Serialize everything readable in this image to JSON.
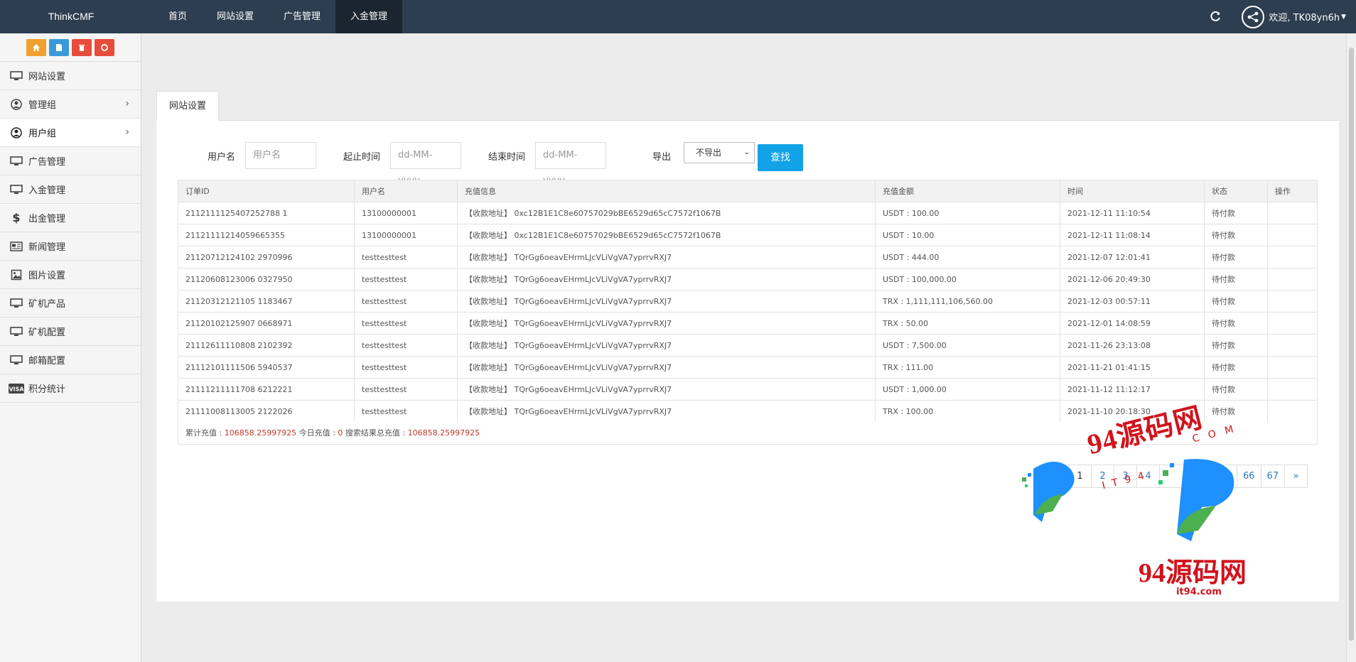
{
  "brand": "ThinkCMF",
  "nav": [
    {
      "label": "首页",
      "active": false
    },
    {
      "label": "网站设置",
      "active": false
    },
    {
      "label": "广告管理",
      "active": false
    },
    {
      "label": "入金管理",
      "active": true
    }
  ],
  "user": {
    "welcome": "欢迎, TK08yn6h"
  },
  "sidebar": {
    "items": [
      {
        "label": "网站设置",
        "icon": "monitor-icon"
      },
      {
        "label": "管理组",
        "icon": "user-circle-icon",
        "has_children": true
      },
      {
        "label": "用户组",
        "icon": "user-circle-icon",
        "has_children": true,
        "active": true
      },
      {
        "label": "广告管理",
        "icon": "monitor-icon"
      },
      {
        "label": "入金管理",
        "icon": "monitor-icon"
      },
      {
        "label": "出金管理",
        "icon": "dollar-icon"
      },
      {
        "label": "新闻管理",
        "icon": "newspaper-icon"
      },
      {
        "label": "图片设置",
        "icon": "image-icon"
      },
      {
        "label": "矿机产品",
        "icon": "monitor-icon"
      },
      {
        "label": "矿机配置",
        "icon": "monitor-icon"
      },
      {
        "label": "邮箱配置",
        "icon": "monitor-icon"
      },
      {
        "label": "积分统计",
        "icon": "visa-icon"
      }
    ]
  },
  "tab": {
    "label": "网站设置"
  },
  "filters": {
    "username_label": "用户名",
    "username_placeholder": "用户名",
    "start_label": "起止时间",
    "start_placeholder": "dd-MM-yyyy",
    "end_label": "结束时间",
    "end_placeholder": "dd-MM-yyyy",
    "export_label": "导出",
    "export_value": "不导出",
    "search_button": "查找"
  },
  "table": {
    "headers": [
      "订单ID",
      "用户名",
      "充值信息",
      "充值金额",
      "时间",
      "状态",
      "操作"
    ],
    "rows": [
      [
        "2112111125407252788 1",
        "13100000001",
        "【收款地址】 0xc12B1E1C8e60757029bBE6529d65cC7572f1067B",
        "USDT : 100.00",
        "2021-12-11 11:10:54",
        "待付款",
        ""
      ],
      [
        "21121111214059665355",
        "13100000001",
        "【收款地址】 0xc12B1E1C8e60757029bBE6529d65cC7572f1067B",
        "USDT : 10.00",
        "2021-12-11 11:08:14",
        "待付款",
        ""
      ],
      [
        "21120712124102 2970996",
        "testtesttest",
        "【收款地址】 TQrGg6oeavEHrmLJcVLiVgVA7yprrvRXJ7",
        "USDT : 444.00",
        "2021-12-07 12:01:41",
        "待付款",
        ""
      ],
      [
        "21120608123006 0327950",
        "testtesttest",
        "【收款地址】 TQrGg6oeavEHrmLJcVLiVgVA7yprrvRXJ7",
        "USDT : 100,000.00",
        "2021-12-06 20:49:30",
        "待付款",
        ""
      ],
      [
        "21120312121105 1183467",
        "testtesttest",
        "【收款地址】 TQrGg6oeavEHrmLJcVLiVgVA7yprrvRXJ7",
        "TRX : 1,111,111,106,560.00",
        "2021-12-03 00:57:11",
        "待付款",
        ""
      ],
      [
        "21120102125907 0668971",
        "testtesttest",
        "【收款地址】 TQrGg6oeavEHrmLJcVLiVgVA7yprrvRXJ7",
        "TRX : 50.00",
        "2021-12-01 14:08:59",
        "待付款",
        ""
      ],
      [
        "21112611110808 2102392",
        "testtesttest",
        "【收款地址】 TQrGg6oeavEHrmLJcVLiVgVA7yprrvRXJ7",
        "USDT : 7,500.00",
        "2021-11-26 23:13:08",
        "待付款",
        ""
      ],
      [
        "21112101111506 5940537",
        "testtesttest",
        "【收款地址】 TQrGg6oeavEHrmLJcVLiVgVA7yprrvRXJ7",
        "TRX : 111.00",
        "2021-11-21 01:41:15",
        "待付款",
        ""
      ],
      [
        "21111211111708 6212221",
        "testtesttest",
        "【收款地址】 TQrGg6oeavEHrmLJcVLiVgVA7yprrvRXJ7",
        "USDT : 1,000.00",
        "2021-11-12 11:12:17",
        "待付款",
        ""
      ],
      [
        "21111008113005 2122026",
        "testtesttest",
        "【收款地址】 TQrGg6oeavEHrmLJcVLiVgVA7yprrvRXJ7",
        "TRX : 100.00",
        "2021-11-10 20:18:30",
        "待付款",
        ""
      ]
    ]
  },
  "summary": {
    "total_label": "累计充值 : ",
    "total_value": "106858.25997925",
    "today_label": " 今日充值 : ",
    "today_value": "0",
    "search_label": " 搜索结果总充值 : ",
    "search_value": "106858.25997925"
  },
  "pager": {
    "prev": "«",
    "pages": [
      "1",
      "2",
      "3",
      "4"
    ],
    "end_pages": [
      "66",
      "67"
    ],
    "next": "»"
  },
  "watermark": {
    "line1": "94源码网",
    "line2": "94源码网",
    "line3": "it94.com",
    "com": "COM",
    "it94": "IT94"
  },
  "colors": {
    "topbar": "#2c3e50",
    "accent": "#11a2e8",
    "highlight": "#c0392b"
  }
}
